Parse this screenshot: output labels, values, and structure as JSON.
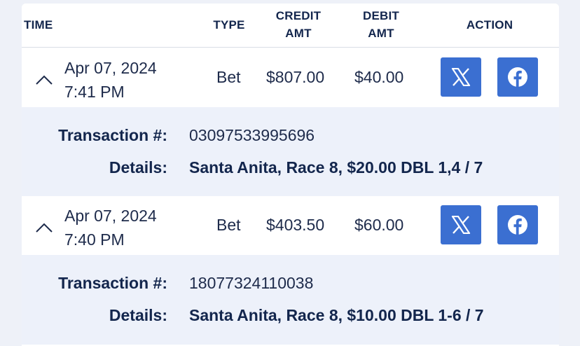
{
  "table": {
    "headers": {
      "time": "TIME",
      "type": "TYPE",
      "credit_line1": "CREDIT",
      "credit_line2": "AMT",
      "debit_line1": "DEBIT",
      "debit_line2": "AMT",
      "action": "ACTION"
    },
    "rows": [
      {
        "date": "Apr 07, 2024",
        "time": "7:41 PM",
        "type": "Bet",
        "credit": "$807.00",
        "debit": "$40.00",
        "transaction_label": "Transaction #:",
        "transaction_number": "03097533995696",
        "details_label": "Details:",
        "details": "Santa Anita, Race 8, $20.00 DBL 1,4 / 7"
      },
      {
        "date": "Apr 07, 2024",
        "time": "7:40 PM",
        "type": "Bet",
        "credit": "$403.50",
        "debit": "$60.00",
        "transaction_label": "Transaction #:",
        "transaction_number": "18077324110038",
        "details_label": "Details:",
        "details": "Santa Anita, Race 8, $10.00 DBL 1-6 / 7"
      }
    ]
  },
  "icons": {
    "expand": "chevron-up-icon",
    "share_x": "x-logo-icon",
    "share_facebook": "facebook-logo-icon"
  },
  "colors": {
    "accent": "#3b6fd1",
    "text": "#13264d",
    "detail_background": "#edf1fa",
    "page_background": "#eef1f8"
  }
}
